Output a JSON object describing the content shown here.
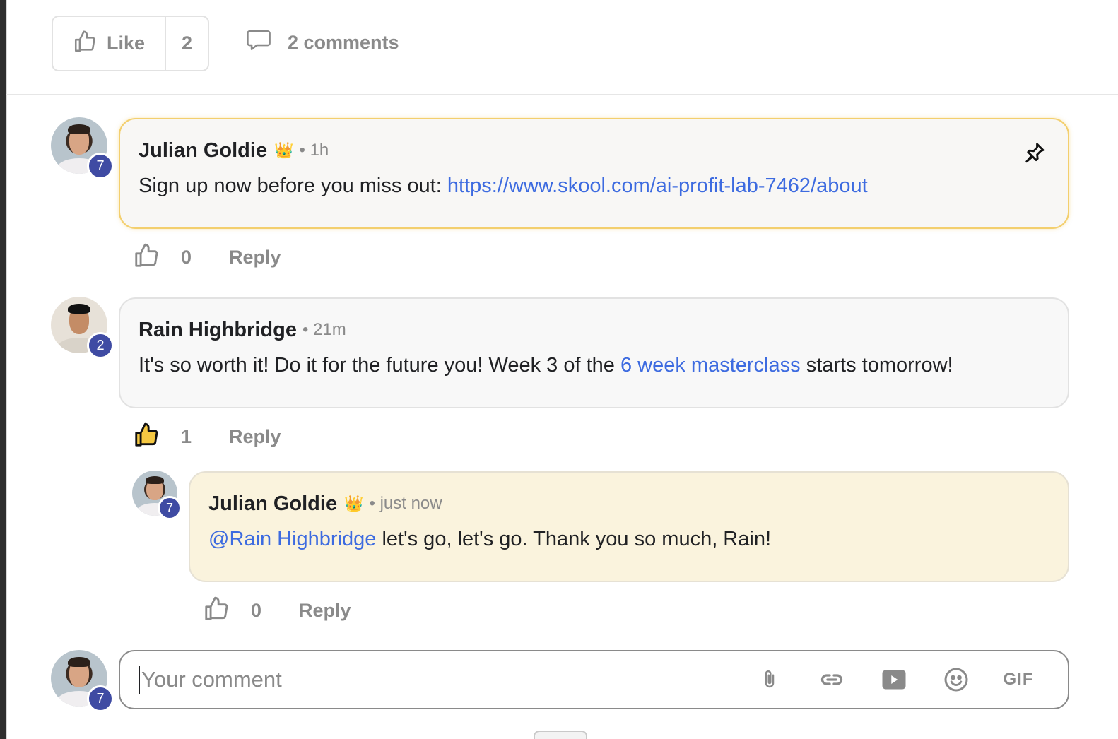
{
  "post_actions": {
    "like_label": "Like",
    "like_count": "2",
    "comments_label": "2 comments"
  },
  "comments": [
    {
      "author": "Julian Goldie",
      "crown": "👑",
      "level": "7",
      "time": "• 1h",
      "text": "Sign up now before you miss out: ",
      "link": "https://www.skool.com/ai-profit-lab-7462/about",
      "likes": "0",
      "reply_label": "Reply"
    },
    {
      "author": "Rain Highbridge",
      "level": "2",
      "time": "• 21m",
      "text_before": "It's so worth it! Do it for the future you! Week 3 of the ",
      "link": "6 week masterclass",
      "text_after": " starts tomorrow!",
      "likes": "1",
      "reply_label": "Reply"
    },
    {
      "author": "Julian Goldie",
      "crown": "👑",
      "level": "7",
      "time": "• just now",
      "mention": "@Rain Highbridge",
      "text_after": " let's go, let's go. Thank you so much, Rain!",
      "likes": "0",
      "reply_label": "Reply"
    }
  ],
  "composer": {
    "level": "7",
    "placeholder": "Your comment",
    "gif_label": "GIF"
  },
  "colors": {
    "pinned_border": "#f3cf6e",
    "link": "#3d6be0",
    "level_badge": "#3f4ba3",
    "reply_bubble": "#faf3dd",
    "liked_thumb": "#f5c842"
  },
  "icons": [
    "thumbs-up-icon",
    "comment-bubble-icon",
    "pin-icon",
    "paperclip-icon",
    "link-icon",
    "video-icon",
    "emoji-icon",
    "crown-icon"
  ]
}
